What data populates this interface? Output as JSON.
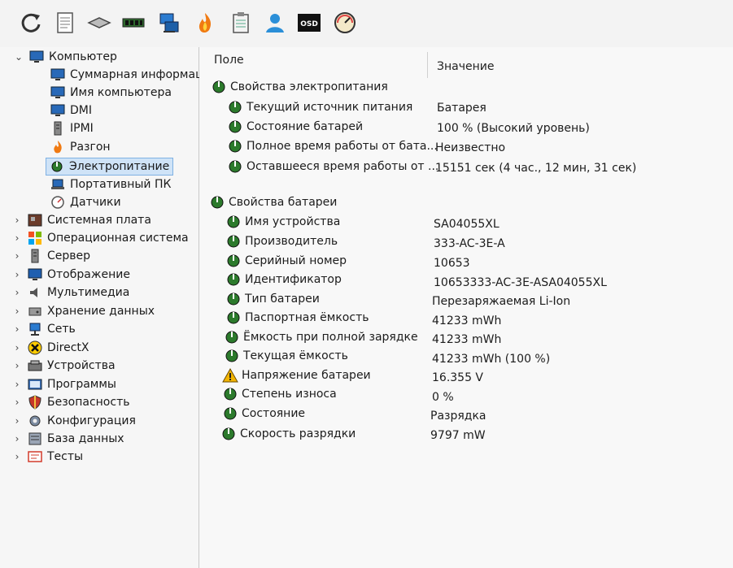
{
  "toolbar": {
    "buttons": [
      {
        "name": "refresh-icon"
      },
      {
        "name": "report-icon"
      },
      {
        "name": "memory-icon"
      },
      {
        "name": "ram-module-icon"
      },
      {
        "name": "network-icon"
      },
      {
        "name": "flame-icon"
      },
      {
        "name": "clipboard-icon"
      },
      {
        "name": "user-icon"
      },
      {
        "name": "osd-icon",
        "label": "OSD"
      },
      {
        "name": "gauge-icon"
      }
    ]
  },
  "tree": {
    "root": "Компьютер",
    "children": [
      "Суммарная информаци",
      "Имя компьютера",
      "DMI",
      "IPMI",
      "Разгон",
      "Электропитание",
      "Портативный ПК",
      "Датчики"
    ],
    "sections": [
      "Системная плата",
      "Операционная система",
      "Сервер",
      "Отображение",
      "Мультимедиа",
      "Хранение данных",
      "Сеть",
      "DirectX",
      "Устройства",
      "Программы",
      "Безопасность",
      "Конфигурация",
      "База данных",
      "Тесты"
    ]
  },
  "table": {
    "headers": {
      "field": "Поле",
      "value": "Значение"
    },
    "group1": {
      "title": "Свойства электропитания",
      "rows": [
        {
          "field": "Текущий источник питания",
          "value": "Батарея"
        },
        {
          "field": "Состояние батарей",
          "value": "100 % (Высокий уровень)"
        },
        {
          "field": "Полное время работы от бата...",
          "value": "Неизвестно"
        },
        {
          "field": "Оставшееся время работы от ...",
          "value": "15151 сек (4 час., 12 мин, 31 сек)"
        }
      ]
    },
    "group2": {
      "title": "Свойства батареи",
      "rows": [
        {
          "field": "Имя устройства",
          "value": "SA04055XL"
        },
        {
          "field": "Производитель",
          "value": "333-AC-3E-A"
        },
        {
          "field": "Серийный номер",
          "value": "10653"
        },
        {
          "field": "Идентификатор",
          "value": "10653333-AC-3E-ASA04055XL"
        },
        {
          "field": "Тип батареи",
          "value": "Перезаряжаемая Li-Ion"
        },
        {
          "field": "Паспортная ёмкость",
          "value": "41233 mWh"
        },
        {
          "field": "Ёмкость при полной зарядке",
          "value": "41233 mWh"
        },
        {
          "field": "Текущая ёмкость",
          "value": "41233 mWh  (100 %)"
        },
        {
          "field": "Напряжение батареи",
          "value": "16.355 V",
          "icon": "warning-icon"
        },
        {
          "field": "Степень износа",
          "value": "0 %"
        },
        {
          "field": "Состояние",
          "value": "Разрядка"
        },
        {
          "field": "Скорость разрядки",
          "value": "9797 mW"
        }
      ]
    }
  },
  "colors": {
    "selection_bg": "#cfe3f7",
    "selection_border": "#7fb1e3",
    "warning": "#f2b400"
  }
}
